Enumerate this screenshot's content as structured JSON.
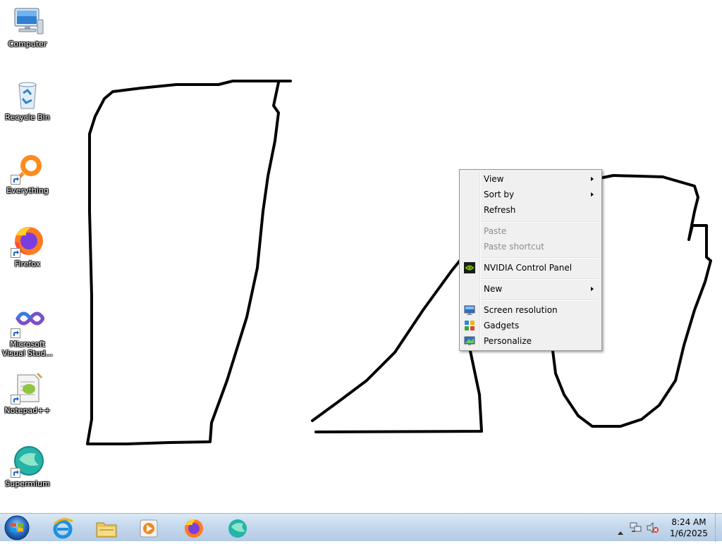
{
  "desktop": {
    "icons": [
      {
        "label": "Computer"
      },
      {
        "label": "Recycle Bin"
      },
      {
        "label": "Everything"
      },
      {
        "label": "Firefox"
      },
      {
        "label": "Microsoft Visual Stud..."
      },
      {
        "label": "Notepad++"
      },
      {
        "label": "Supermium"
      }
    ]
  },
  "context_menu": {
    "items": [
      {
        "label": "View",
        "has_submenu": true
      },
      {
        "label": "Sort by",
        "has_submenu": true
      },
      {
        "label": "Refresh"
      },
      {
        "label": "Paste",
        "disabled": true
      },
      {
        "label": "Paste shortcut",
        "disabled": true
      },
      {
        "label": "NVIDIA Control Panel",
        "icon": "nvidia-icon"
      },
      {
        "label": "New",
        "has_submenu": true
      },
      {
        "label": "Screen resolution",
        "icon": "screen-resolution-icon"
      },
      {
        "label": "Gadgets",
        "icon": "gadgets-icon"
      },
      {
        "label": "Personalize",
        "icon": "personalize-icon"
      }
    ]
  },
  "taskbar": {
    "pinned": [
      "internet-explorer-icon",
      "windows-explorer-icon",
      "media-player-icon",
      "firefox-icon",
      "supermium-icon"
    ],
    "tray": {
      "time": "8:24 AM",
      "date": "1/6/2025"
    }
  },
  "colors": {
    "taskbar_top": "#dbe8f5",
    "menu_bg": "#f0f0f0",
    "drawing_stroke": "#000000"
  }
}
